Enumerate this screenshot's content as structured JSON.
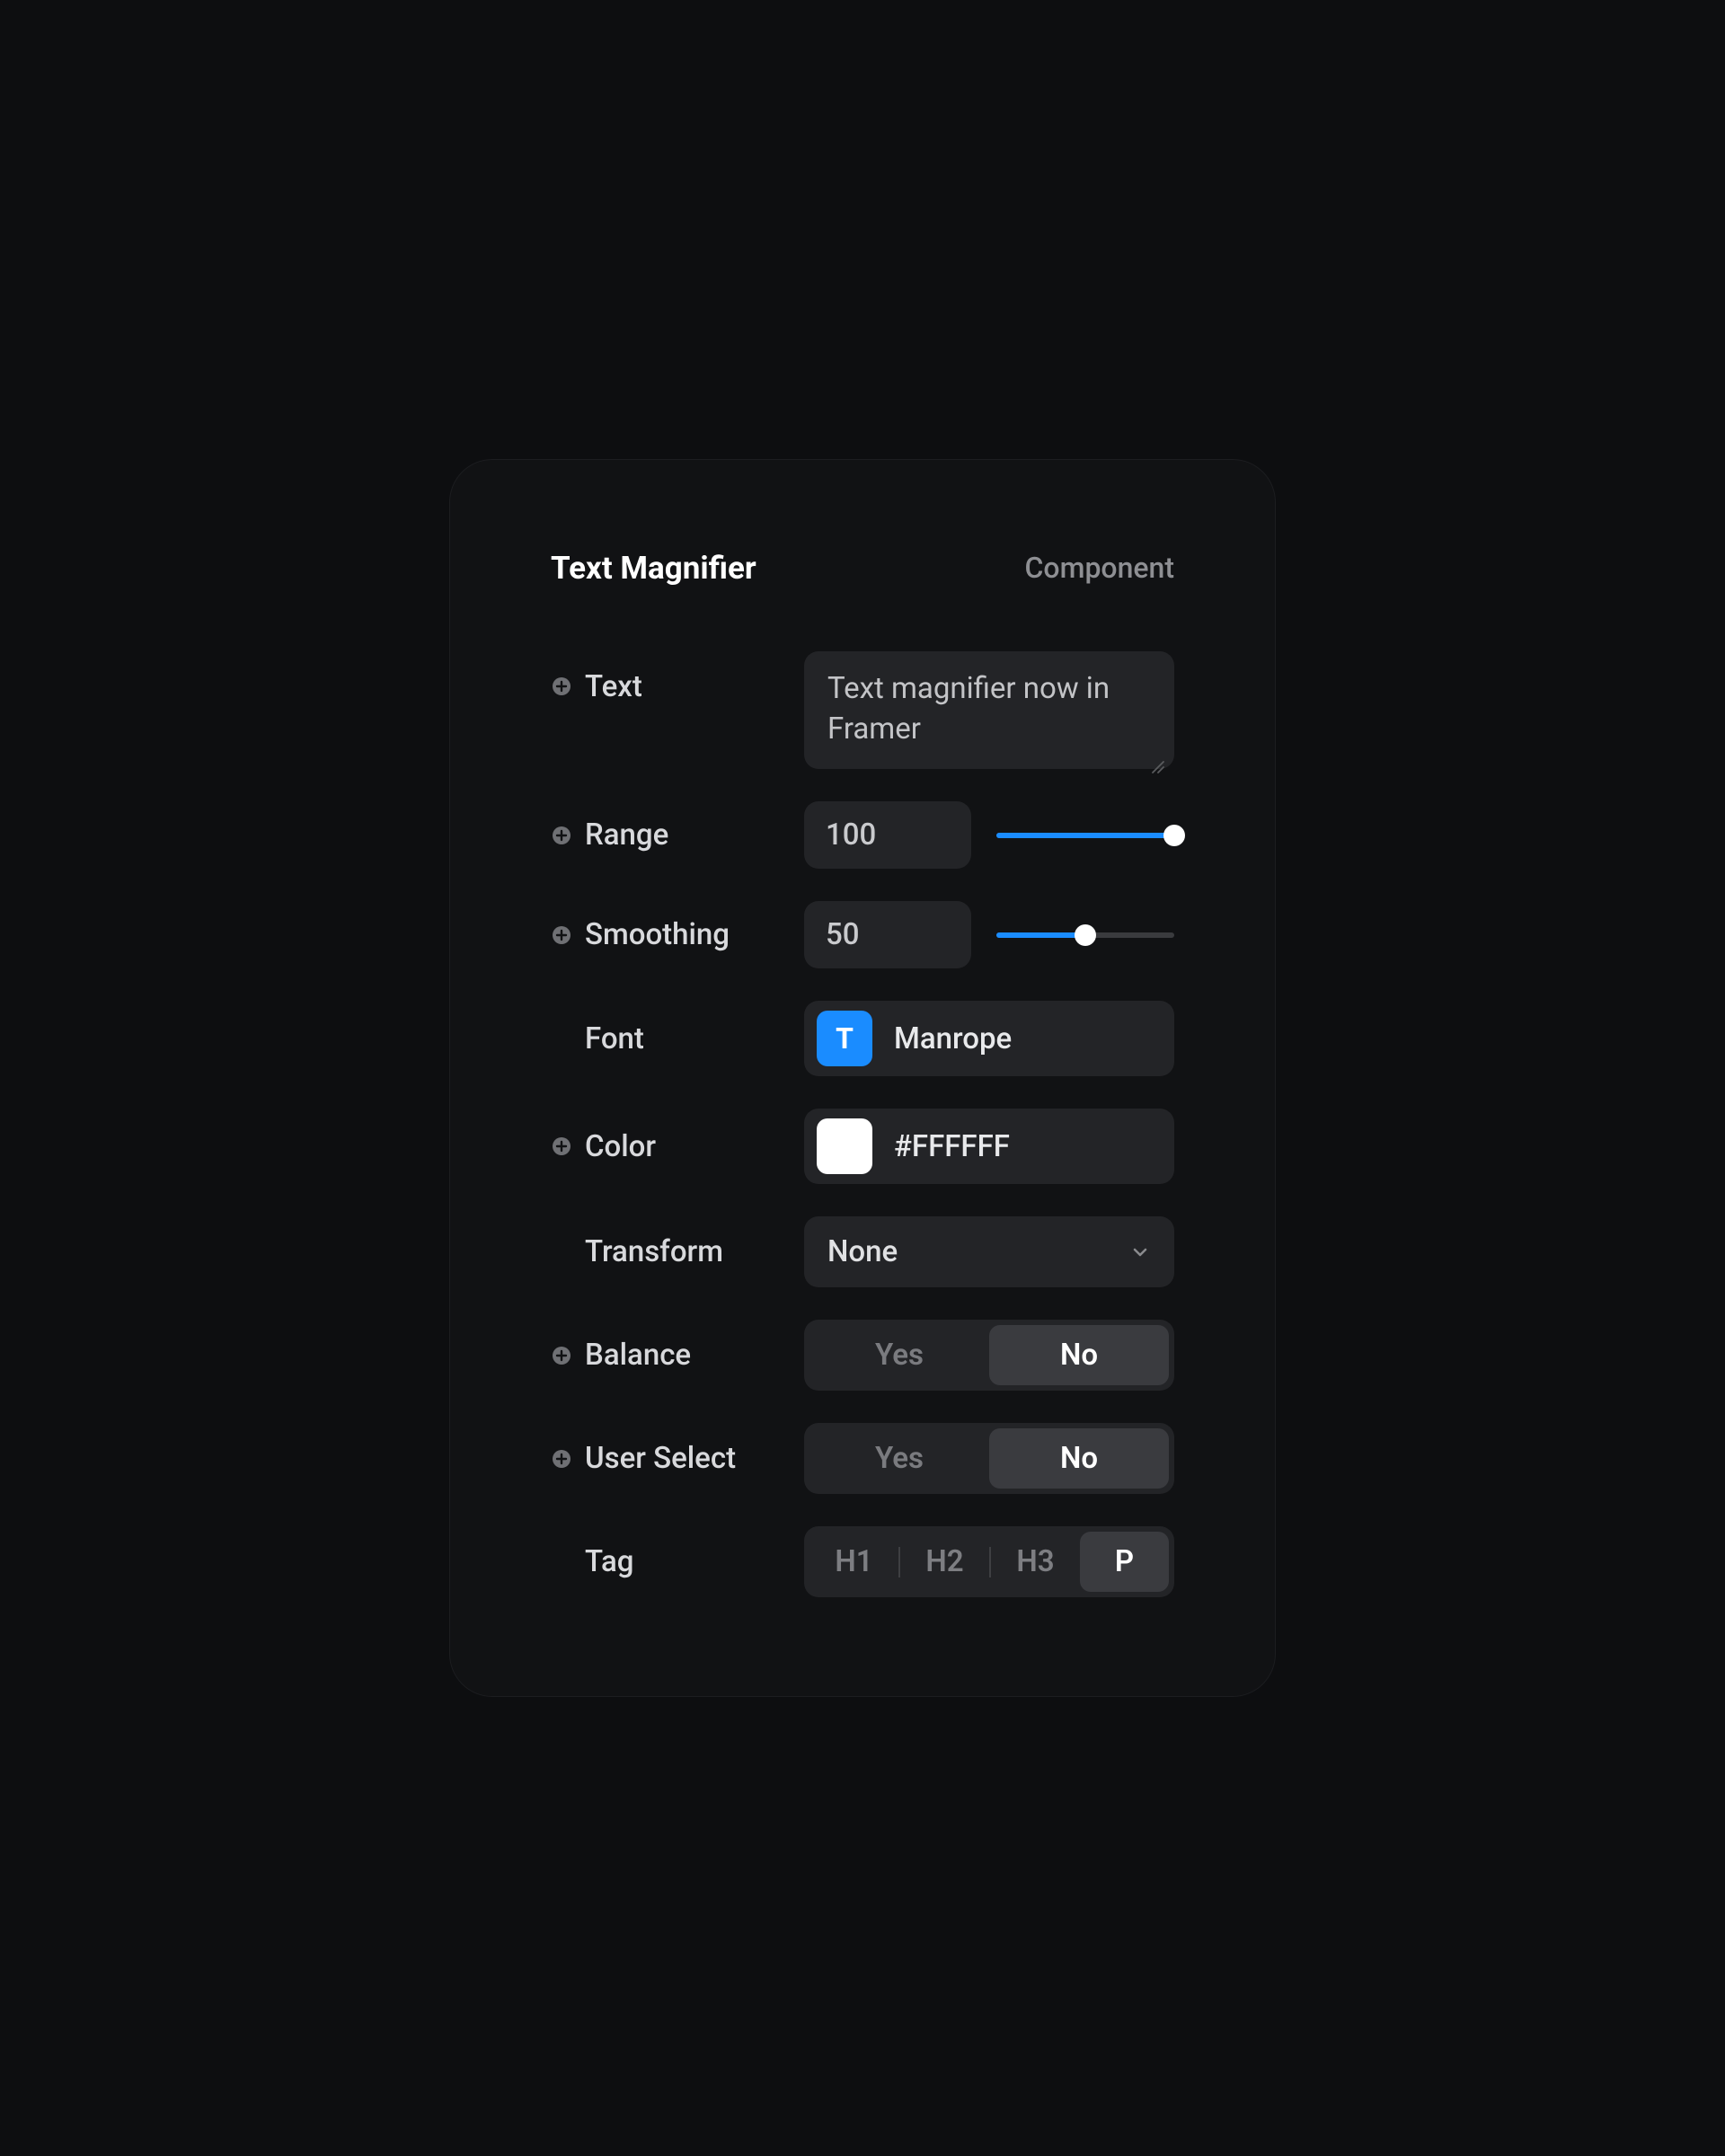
{
  "header": {
    "title": "Text Magnifier",
    "subtitle": "Component"
  },
  "controls": {
    "text": {
      "label": "Text",
      "value": "Text magnifier now in Framer"
    },
    "range": {
      "label": "Range",
      "value": "100",
      "percent": 100
    },
    "smoothing": {
      "label": "Smoothing",
      "value": "50",
      "percent": 50
    },
    "font": {
      "label": "Font",
      "icon_letter": "T",
      "name": "Manrope"
    },
    "color": {
      "label": "Color",
      "value": "#FFFFFF",
      "swatch": "#FFFFFF"
    },
    "transform": {
      "label": "Transform",
      "value": "None"
    },
    "balance": {
      "label": "Balance",
      "yes": "Yes",
      "no": "No",
      "selected": "no"
    },
    "user_select": {
      "label": "User Select",
      "yes": "Yes",
      "no": "No",
      "selected": "no"
    },
    "tag": {
      "label": "Tag",
      "options": [
        "H1",
        "H2",
        "H3",
        "P"
      ],
      "selected": "P"
    }
  }
}
